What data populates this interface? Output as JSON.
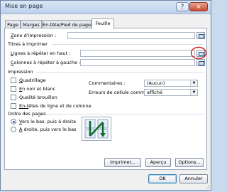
{
  "window": {
    "title": "Mise en page",
    "help_glyph": "?",
    "close_glyph": "×"
  },
  "tabs": [
    {
      "label": "Page",
      "active": false
    },
    {
      "label": "Marges",
      "active": false
    },
    {
      "label": "En-tête/Pied de page",
      "active": false
    },
    {
      "label": "Feuille",
      "active": true
    }
  ],
  "print_area": {
    "label_key": "Z",
    "label_rest": "one d'impression :",
    "value": ""
  },
  "titles": {
    "heading": "Titres à imprimer",
    "rows_key": "L",
    "rows_rest": "ignes à répéter en haut :",
    "rows_value": "",
    "cols_key": "C",
    "cols_rest": "olonnes à répéter à gauche :",
    "cols_value": ""
  },
  "print": {
    "heading": "Impression",
    "options": [
      {
        "key": "Q",
        "rest": "uadrillage",
        "checked": false
      },
      {
        "key": "E",
        "rest": "n noir et blanc",
        "checked": false
      },
      {
        "key": "",
        "rest": "Qualité brouillon",
        "checked": false
      },
      {
        "key": "En-t",
        "rest": "êtes de ligne et de colonne",
        "checked": false
      }
    ],
    "comments_label": "Commentaires :",
    "comments_value": "(Aucun)",
    "errors_label": "Erreurs de cellule comme :",
    "errors_value": "affiché"
  },
  "page_order": {
    "heading": "Ordre des pages",
    "down_key": "V",
    "down_rest": "ers le bas, puis à droite",
    "down_selected": true,
    "over_key": "À",
    "over_rest": " droite, puis vers le bas",
    "over_selected": false
  },
  "buttons": {
    "print": "Imprimer...",
    "preview": "Aperçu",
    "options": "Options...",
    "ok": "OK",
    "cancel": "Annuler"
  },
  "colors": {
    "accent": "#2c62b1",
    "highlight_circle": "#d0201a"
  }
}
